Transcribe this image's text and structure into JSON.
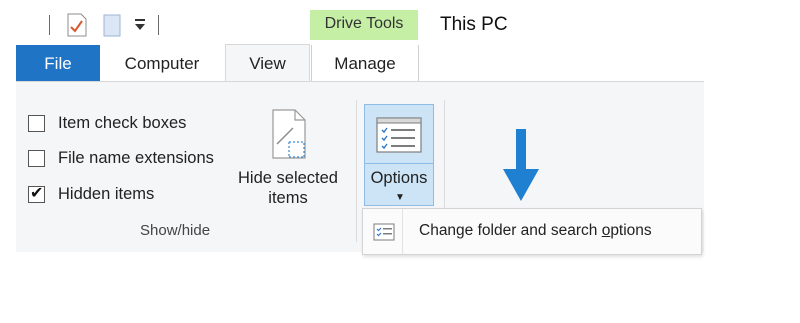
{
  "quick_access": {
    "icons": [
      "properties-icon",
      "new-folder-icon",
      "customize-quick-access-icon"
    ]
  },
  "contextual_tab_group": {
    "label": "Drive Tools",
    "color": "#c6efa6"
  },
  "window": {
    "title": "This PC"
  },
  "tabs": [
    {
      "label": "File",
      "active": false,
      "color": "#1f74c6"
    },
    {
      "label": "Computer",
      "active": false
    },
    {
      "label": "View",
      "active": true
    },
    {
      "label": "Manage",
      "active": false
    }
  ],
  "ribbon": {
    "show_hide": {
      "group_label": "Show/hide",
      "checkboxes": [
        {
          "label": "Item check boxes",
          "checked": false
        },
        {
          "label": "File name extensions",
          "checked": false
        },
        {
          "label": "Hidden items",
          "checked": true
        }
      ],
      "hide_selected": {
        "line1": "Hide selected",
        "line2": "items"
      }
    },
    "options": {
      "label": "Options",
      "accent": "#cde4f7"
    }
  },
  "dropdown": {
    "item_prefix": "Change folder and search ",
    "item_accel": "o",
    "item_suffix": "ptions"
  },
  "annotation": {
    "arrow_color": "#1f7fd0",
    "icon": "down-arrow-icon"
  }
}
